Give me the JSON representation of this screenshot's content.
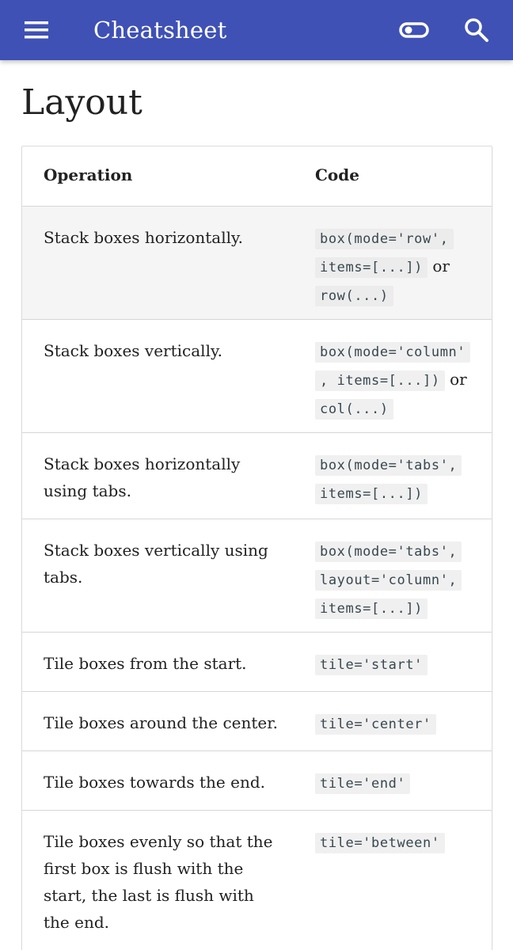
{
  "appbar": {
    "title": "Cheatsheet",
    "menu_icon": "menu-icon",
    "toggle_icon": "toggle-icon",
    "search_icon": "search-icon",
    "color": "#3f51b5"
  },
  "page": {
    "title": "Layout"
  },
  "table": {
    "headers": {
      "operation": "Operation",
      "code": "Code"
    },
    "rows": [
      {
        "operation": "Stack boxes horizontally.",
        "code": [
          "box(mode='row',",
          "items=[...])",
          "row(...)"
        ],
        "connector": "or"
      },
      {
        "operation": "Stack boxes vertically.",
        "code": [
          "box(mode='column'",
          ", items=[...])",
          "col(...)"
        ],
        "connector": "or"
      },
      {
        "operation": "Stack boxes horizontally using tabs.",
        "code": [
          "box(mode='tabs',",
          "items=[...])"
        ]
      },
      {
        "operation": "Stack boxes vertically using tabs.",
        "code": [
          "box(mode='tabs',",
          "layout='column',",
          "items=[...])"
        ]
      },
      {
        "operation": "Tile boxes from the start.",
        "code": [
          "tile='start'"
        ]
      },
      {
        "operation": "Tile boxes around the center.",
        "code": [
          "tile='center'"
        ]
      },
      {
        "operation": "Tile boxes towards the end.",
        "code": [
          "tile='end'"
        ]
      },
      {
        "operation": "Tile boxes evenly so that the first box is flush with the start, the last is flush with the end.",
        "code": [
          "tile='between'"
        ]
      }
    ]
  }
}
